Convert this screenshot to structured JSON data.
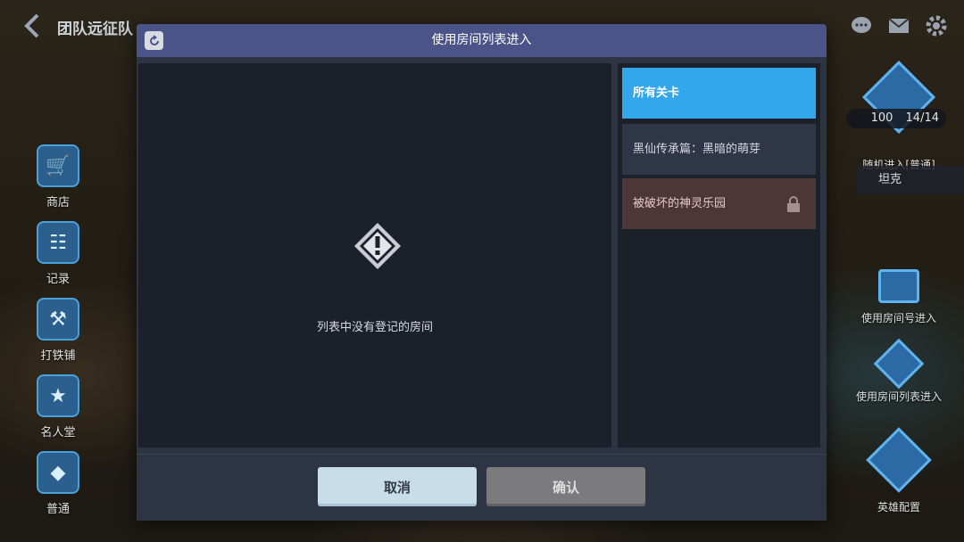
{
  "background": {
    "title": "团队远征队",
    "side_menu": [
      {
        "label": "商店",
        "icon": "cart-icon"
      },
      {
        "label": "记录",
        "icon": "clipboard-icon"
      },
      {
        "label": "打铁铺",
        "icon": "anvil-icon"
      },
      {
        "label": "名人堂",
        "icon": "hall-of-fame-icon"
      },
      {
        "label": "普通",
        "icon": "emblem-icon"
      }
    ],
    "stamina": "100",
    "entries": "14/14",
    "random_enter": "随机进入[普通]",
    "role": "坦克",
    "room_number_enter": "使用房间号进入",
    "room_list_enter": "使用房间列表进入",
    "hero_config": "英雄配置"
  },
  "dialog": {
    "title": "使用房间列表进入",
    "empty_message": "列表中没有登记的房间",
    "stages": [
      {
        "label": "所有关卡",
        "state": "selected"
      },
      {
        "label": "黑仙传承篇：黑暗的萌芽",
        "state": "normal"
      },
      {
        "label": "被破坏的神灵乐园",
        "state": "locked"
      }
    ],
    "cancel_label": "取消",
    "confirm_label": "确认"
  },
  "colors": {
    "header": "#4b5488",
    "selected_stage": "#34a7ec",
    "locked_stage": "#4e3538",
    "cancel_button": "#c7dde9",
    "confirm_button": "#7b7b7d"
  }
}
